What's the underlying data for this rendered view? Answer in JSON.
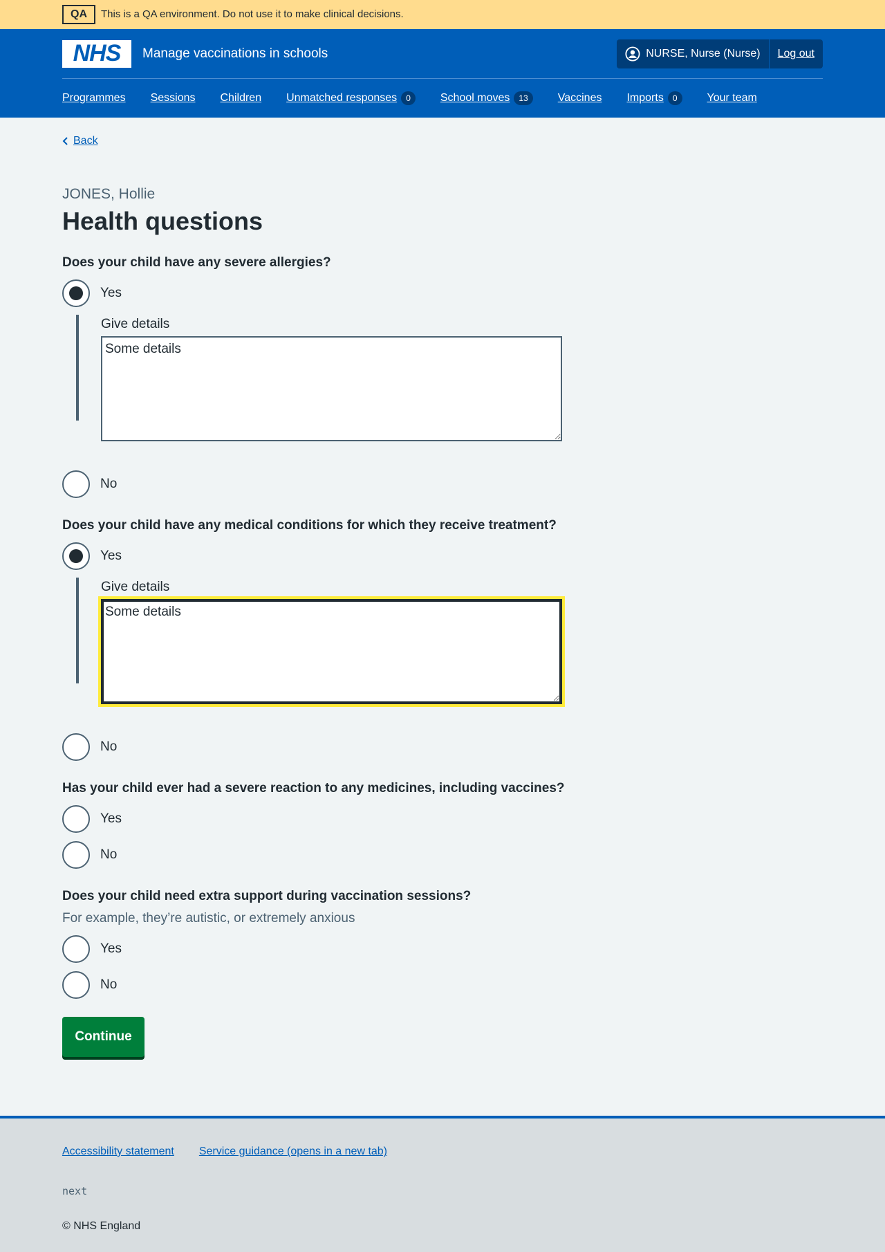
{
  "qa_banner": {
    "tag": "QA",
    "message": "This is a QA environment. Do not use it to make clinical decisions."
  },
  "header": {
    "logo": "NHS",
    "service_name": "Manage vaccinations in schools",
    "user": "NURSE, Nurse (Nurse)",
    "logout": "Log out",
    "nav": [
      {
        "label": "Programmes"
      },
      {
        "label": "Sessions"
      },
      {
        "label": "Children"
      },
      {
        "label": "Unmatched responses",
        "count": "0"
      },
      {
        "label": "School moves",
        "count": "13"
      },
      {
        "label": "Vaccines"
      },
      {
        "label": "Imports",
        "count": "0"
      },
      {
        "label": "Your team"
      }
    ]
  },
  "back": "Back",
  "caption": "JONES, Hollie",
  "title": "Health questions",
  "questions": [
    {
      "legend": "Does your child have any severe allergies?",
      "yes": "Yes",
      "no": "No",
      "selected": "yes",
      "details_label": "Give details",
      "details_value": "Some details"
    },
    {
      "legend": "Does your child have any medical conditions for which they receive treatment?",
      "yes": "Yes",
      "no": "No",
      "selected": "yes",
      "details_label": "Give details",
      "details_value": "Some details"
    },
    {
      "legend": "Has your child ever had a severe reaction to any medicines, including vaccines?",
      "yes": "Yes",
      "no": "No",
      "selected": ""
    },
    {
      "legend": "Does your child need extra support during vaccination sessions?",
      "hint": "For example, they’re autistic, or extremely anxious",
      "yes": "Yes",
      "no": "No",
      "selected": ""
    }
  ],
  "continue": "Continue",
  "footer": {
    "links": [
      "Accessibility statement",
      "Service guidance (opens in a new tab)"
    ],
    "version": "next",
    "copyright": "© NHS England"
  }
}
